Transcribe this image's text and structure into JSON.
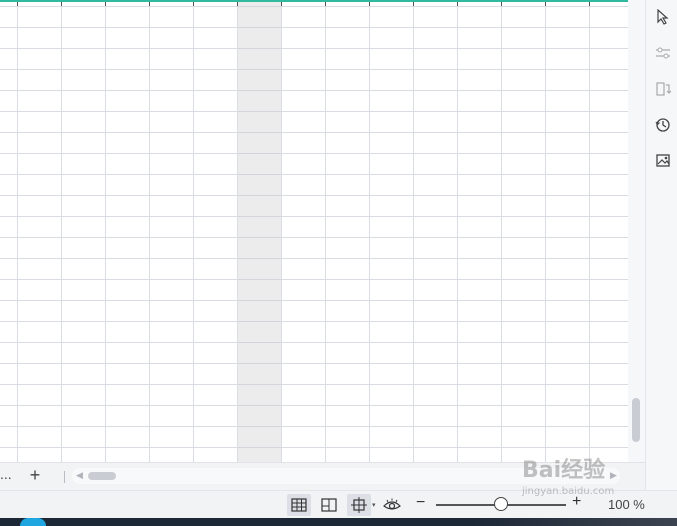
{
  "right_panel": {
    "icons": [
      "cursor-select-icon",
      "filter-settings-icon",
      "transpose-icon",
      "history-icon",
      "image-gallery-icon"
    ]
  },
  "sheet_bar": {
    "more_label": "...",
    "add_sheet_label": "+"
  },
  "status_bar": {
    "view_buttons": [
      "normal-view-icon",
      "page-layout-view-icon",
      "page-break-view-icon",
      "eye-protection-icon"
    ],
    "zoom_minus_label": "−",
    "zoom_plus_label": "+",
    "zoom_level": "100 %",
    "zoom_fraction": 0.5
  },
  "watermark": {
    "text": "Bai经验",
    "sub": "jingyan.baidu.com"
  },
  "colors": {
    "accent_line": "#2fb99f",
    "grid_line": "#d9dce3",
    "selected_column": "#e8e8e8",
    "taskbar": "#1d2836",
    "task_blue": "#1fa6e0"
  }
}
